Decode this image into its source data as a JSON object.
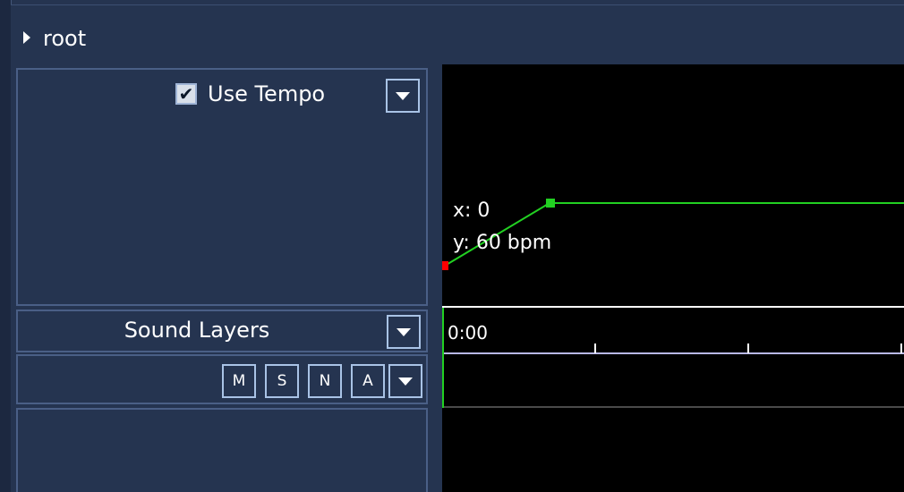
{
  "header": {
    "title": "root",
    "arrow_icon": "triangle-right-icon"
  },
  "tempo_panel": {
    "use_tempo_label": "Use Tempo",
    "use_tempo_checked": true,
    "checkbox_glyph": "✔",
    "dropdown_icon": "triangle-down-icon"
  },
  "tempo_readout": {
    "x": "x: 0",
    "y": "y: 60 bpm"
  },
  "sound_layers": {
    "label": "Sound Layers",
    "dropdown_icon": "triangle-down-icon"
  },
  "layer_buttons": {
    "m": "M",
    "s": "S",
    "n": "N",
    "a": "A"
  },
  "timeline": {
    "start_label": "0:00"
  },
  "colors": {
    "panel_bg": "#253450",
    "canvas_bg": "#000000",
    "tempo_line": "#22d022",
    "start_point": "#ff0000",
    "timeline_ruler": "#b8b8e8",
    "button_border": "#a9c3e6"
  }
}
